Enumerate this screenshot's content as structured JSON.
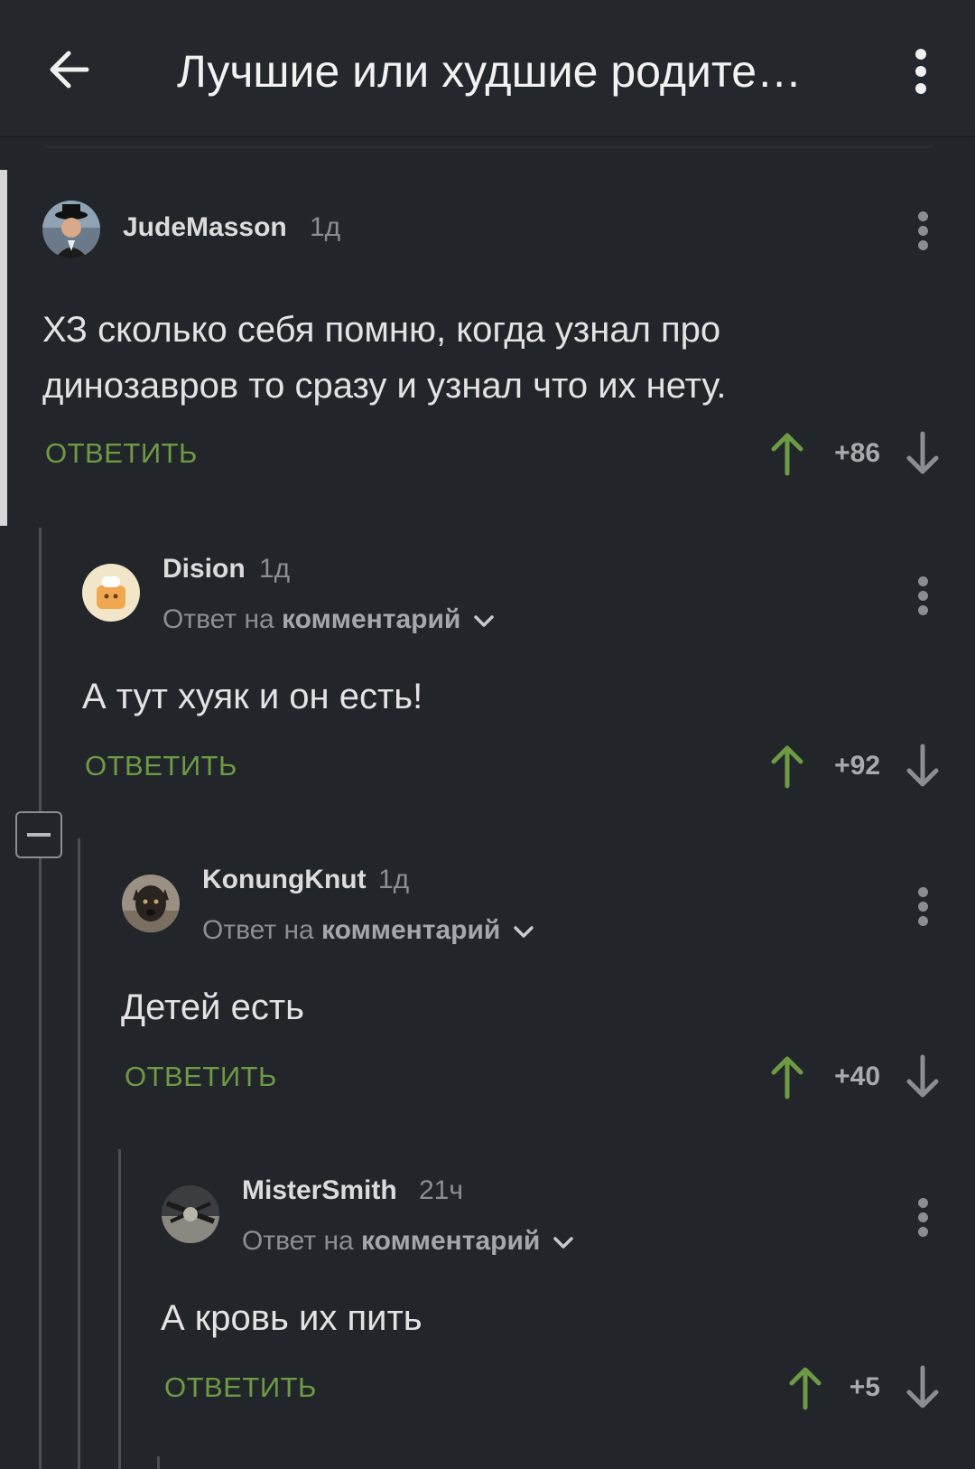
{
  "header": {
    "title": "Лучшие или худшие родите…"
  },
  "comments": [
    {
      "username": "JudeMasson",
      "time": "1д",
      "text_line1": "ХЗ сколько себя помню, когда узнал про",
      "text_line2": "динозавров то сразу и узнал что их нету.",
      "reply_label": "ОТВЕТИТЬ",
      "score": "+86"
    },
    {
      "username": "Dision",
      "time": "1д",
      "reply_prefix": "Ответ на",
      "reply_target": "комментарий",
      "text": "А тут хуяк и он есть!",
      "reply_label": "ОТВЕТИТЬ",
      "score": "+92"
    },
    {
      "username": "KonungKnut",
      "time": "1д",
      "reply_prefix": "Ответ на",
      "reply_target": "комментарий",
      "text": "Детей есть",
      "reply_label": "ОТВЕТИТЬ",
      "score": "+40"
    },
    {
      "username": "MisterSmith",
      "time": "21ч",
      "reply_prefix": "Ответ на",
      "reply_target": "комментарий",
      "text": "А кровь их пить",
      "reply_label": "ОТВЕТИТЬ",
      "score": "+5"
    }
  ],
  "colors": {
    "background": "#22262b",
    "reply_green": "#6e9a44",
    "upvote_green": "#6e9a44",
    "muted": "#8b8f93"
  },
  "icons": [
    "back-arrow-icon",
    "more-vertical-icon",
    "upvote-arrow-icon",
    "downvote-arrow-icon",
    "chevron-down-icon",
    "collapse-minus-icon"
  ]
}
